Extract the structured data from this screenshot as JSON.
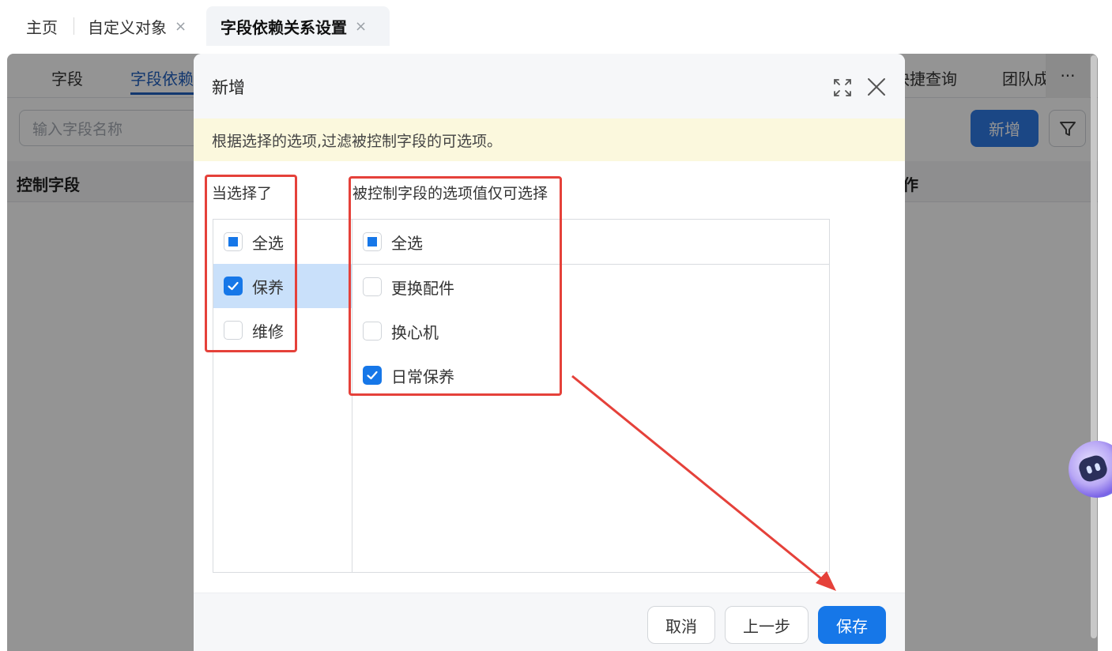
{
  "tabs": {
    "home": "主页",
    "custom_object": "自定义对象",
    "active": "字段依赖关系设置",
    "close_glyph": "×"
  },
  "background": {
    "subtabs": [
      "字段",
      "字段依赖",
      "快捷查询",
      "团队成"
    ],
    "more_label": "···",
    "search_placeholder": "输入字段名称",
    "add_button": "新增",
    "table_headers": [
      "控制字段",
      "作"
    ]
  },
  "modal": {
    "title": "新增",
    "notice": "根据选择的选项,过滤被控制字段的可选项。",
    "left_title": "当选择了",
    "right_title": "被控制字段的选项值仅可选择",
    "left_options": [
      {
        "label": "全选",
        "state": "indeterminate"
      },
      {
        "label": "保养",
        "state": "checked"
      },
      {
        "label": "维修",
        "state": "unchecked"
      }
    ],
    "right_options": [
      {
        "label": "全选",
        "state": "indeterminate"
      },
      {
        "label": "更换配件",
        "state": "unchecked"
      },
      {
        "label": "换心机",
        "state": "unchecked"
      },
      {
        "label": "日常保养",
        "state": "checked"
      }
    ],
    "buttons": {
      "cancel": "取消",
      "previous": "上一步",
      "save": "保存"
    }
  },
  "colors": {
    "primary": "#1677e8",
    "annotation": "#e5413a",
    "selected_row": "#c9e0fa",
    "notice_bg": "#fbf8dd"
  }
}
